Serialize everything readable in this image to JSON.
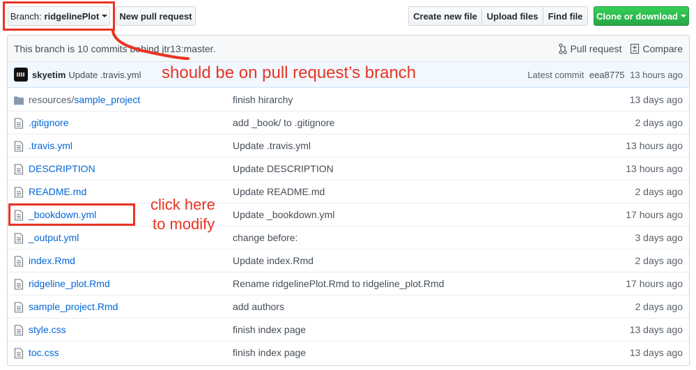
{
  "toolbar": {
    "branch_prefix": "Branch:",
    "branch_name": "ridgelinePlot",
    "new_pr": "New pull request",
    "create_file": "Create new file",
    "upload_files": "Upload files",
    "find_file": "Find file",
    "clone": "Clone or download"
  },
  "behind_bar": {
    "text": "This branch is 10 commits behind jtr13:master.",
    "pull_request": "Pull request",
    "compare": "Compare"
  },
  "latest_commit": {
    "author": "skyetim",
    "message": "Update .travis.yml",
    "label": "Latest commit",
    "sha": "eea8775",
    "age": "13 hours ago"
  },
  "files": [
    {
      "prefix": "resources/",
      "name": "sample_project",
      "type": "folder",
      "message": "finish hirarchy",
      "age": "13 days ago"
    },
    {
      "prefix": "",
      "name": ".gitignore",
      "type": "file",
      "message": "add _book/ to .gitignore",
      "age": "2 days ago"
    },
    {
      "prefix": "",
      "name": ".travis.yml",
      "type": "file",
      "message": "Update .travis.yml",
      "age": "13 hours ago"
    },
    {
      "prefix": "",
      "name": "DESCRIPTION",
      "type": "file",
      "message": "Update DESCRIPTION",
      "age": "13 hours ago"
    },
    {
      "prefix": "",
      "name": "README.md",
      "type": "file",
      "message": "Update README.md",
      "age": "2 days ago"
    },
    {
      "prefix": "",
      "name": "_bookdown.yml",
      "type": "file",
      "message": "Update _bookdown.yml",
      "age": "17 hours ago"
    },
    {
      "prefix": "",
      "name": "_output.yml",
      "type": "file",
      "message": "change before:",
      "age": "3 days ago"
    },
    {
      "prefix": "",
      "name": "index.Rmd",
      "type": "file",
      "message": "Update index.Rmd",
      "age": "2 days ago"
    },
    {
      "prefix": "",
      "name": "ridgeline_plot.Rmd",
      "type": "file",
      "message": "Rename ridgelinePlot.Rmd to ridgeline_plot.Rmd",
      "age": "17 hours ago"
    },
    {
      "prefix": "",
      "name": "sample_project.Rmd",
      "type": "file",
      "message": "add authors",
      "age": "2 days ago"
    },
    {
      "prefix": "",
      "name": "style.css",
      "type": "file",
      "message": "finish index page",
      "age": "13 days ago"
    },
    {
      "prefix": "",
      "name": "toc.css",
      "type": "file",
      "message": "finish index page",
      "age": "13 days ago"
    }
  ],
  "annotations": {
    "branch_note": "should be on pull request’s branch",
    "modify_note_line1": "click here",
    "modify_note_line2": "to modify"
  },
  "colors": {
    "annotation": "#ea3323",
    "link": "#0366d6",
    "green_button": "#28a745"
  }
}
